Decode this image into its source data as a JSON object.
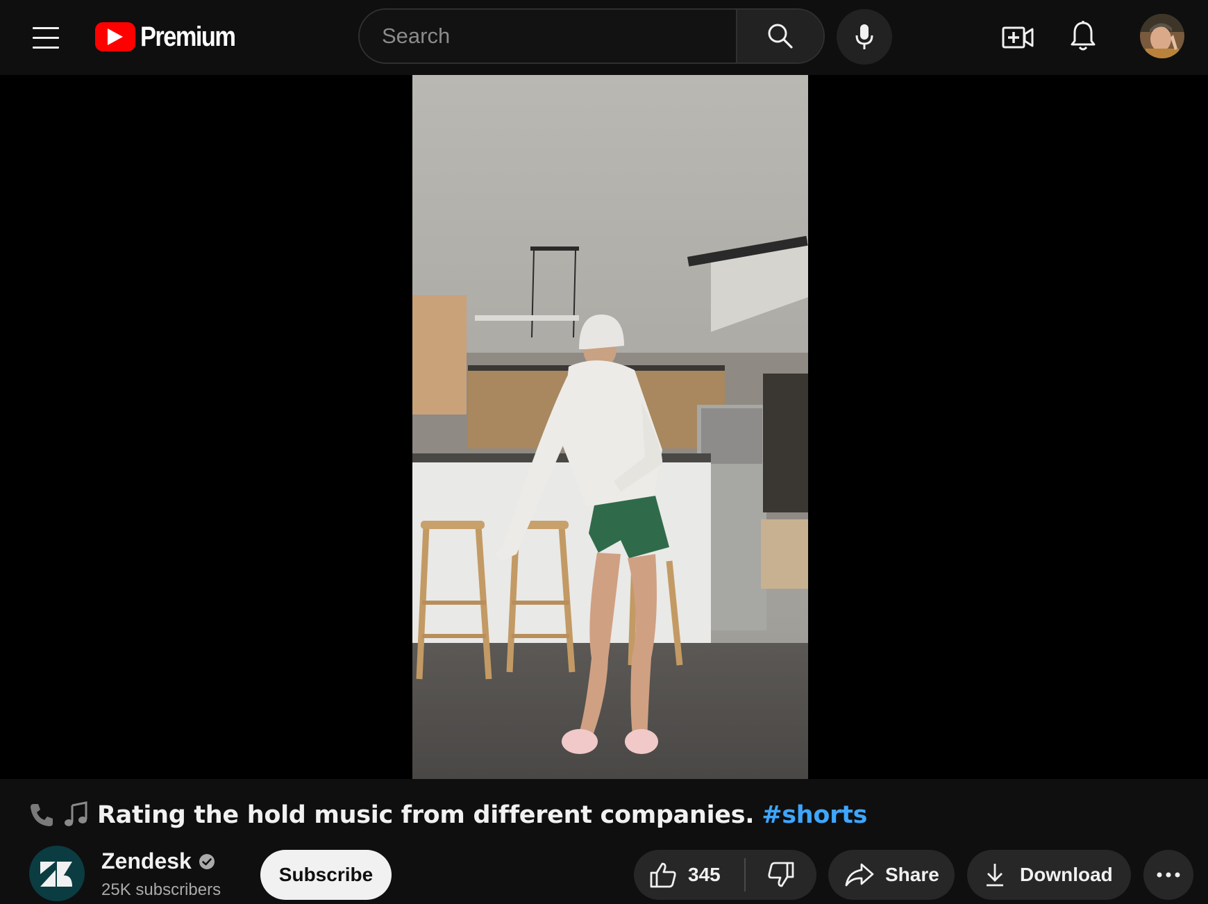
{
  "header": {
    "logo_text": "Premium",
    "search": {
      "placeholder": "Search",
      "value": ""
    }
  },
  "video": {
    "title": "Rating the hold music from different companies.",
    "title_emojis": [
      "phone-icon",
      "music-notes-icon"
    ],
    "hashtag": "#shorts"
  },
  "channel": {
    "name": "Zendesk",
    "verified": true,
    "subscribers": "25K subscribers",
    "subscribe_label": "Subscribe"
  },
  "actions": {
    "like_count": "345",
    "share_label": "Share",
    "download_label": "Download"
  },
  "colors": {
    "background": "#0f0f0f",
    "player_background": "#000000",
    "brand_red": "#ff0000",
    "hashtag_blue": "#3ea6ff",
    "button_pill": "#272727",
    "subscribe_bg": "#f1f1f1"
  }
}
